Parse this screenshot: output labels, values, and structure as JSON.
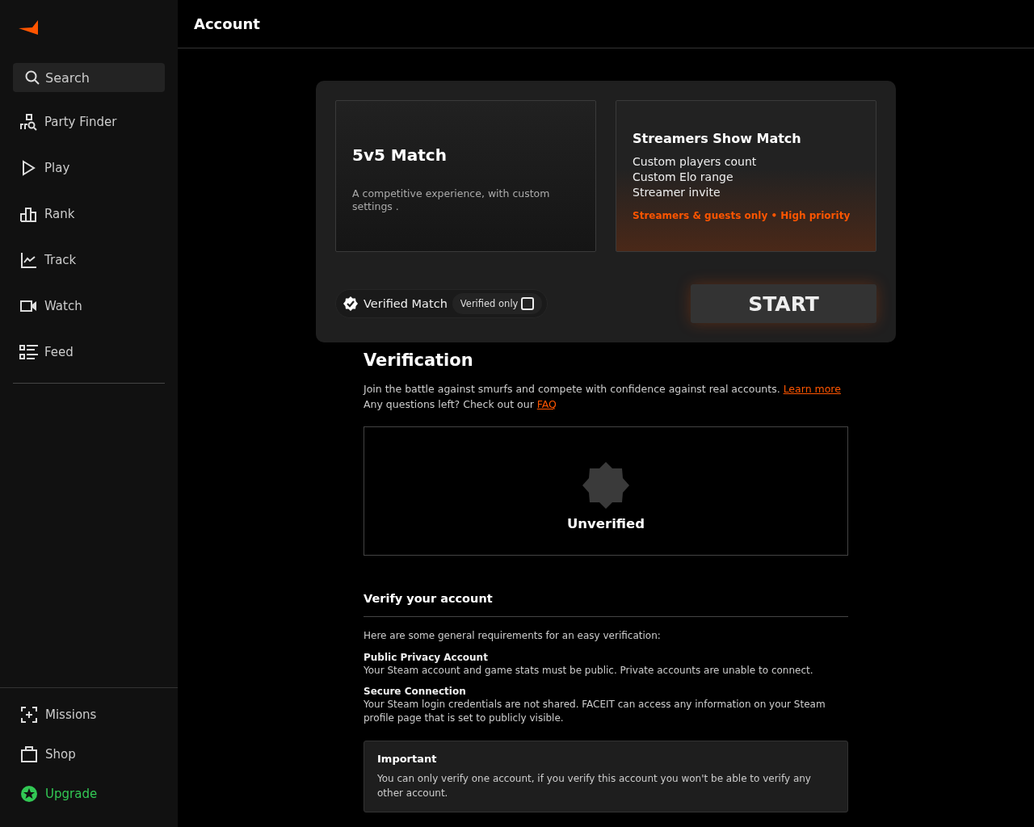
{
  "sidebar": {
    "search": {
      "placeholder": "Search"
    },
    "items": [
      {
        "label": "Party Finder",
        "kind": "party"
      },
      {
        "label": "Play",
        "kind": "play"
      },
      {
        "label": "Rank",
        "kind": "rank"
      },
      {
        "label": "Track",
        "kind": "track"
      },
      {
        "label": "Watch",
        "kind": "watch"
      },
      {
        "label": "Feed",
        "kind": "feed"
      }
    ],
    "footer_items": [
      {
        "label": "Missions",
        "kind": "missions"
      },
      {
        "label": "Shop",
        "kind": "shop"
      },
      {
        "label": "Upgrade",
        "kind": "upgrade"
      }
    ]
  },
  "header": {
    "title": "Account"
  },
  "match_panel": {
    "cards": [
      {
        "kind": "plain",
        "title": "5v5 Match",
        "description": "A competitive experience, with custom settings ."
      },
      {
        "kind": "featured",
        "title": "Streamers Show Match",
        "features": [
          "Custom players count",
          "Custom Elo range",
          "Streamer invite"
        ],
        "note": "Streamers & guests only • High priority"
      }
    ],
    "verified_match": {
      "label": "Verified Match",
      "toggle_label": "Verified only",
      "checked": false
    },
    "start_button": "START"
  },
  "verification": {
    "title": "Verification",
    "intro": "Join the battle against smurfs and compete with confidence against real accounts.",
    "intro_link": "Learn more",
    "faq_text": "Any questions left? Check out our",
    "faq_link": "FAQ",
    "status": "Unverified",
    "verify_title": "Verify your account",
    "requirements_intro": "Here are some general requirements for an easy verification:",
    "requirements": [
      {
        "title": "Public Privacy Account",
        "text": "Your Steam account and game stats must be public. Private accounts are unable to connect."
      },
      {
        "title": "Secure Connection",
        "text": "Your Steam login credentials are not shared. FACEIT can access any information on your Steam profile page that is set to publicly visible."
      }
    ],
    "important": {
      "title": "Important",
      "text": "You can only verify one account, if you verify this account you won't be able to verify any other account."
    }
  }
}
